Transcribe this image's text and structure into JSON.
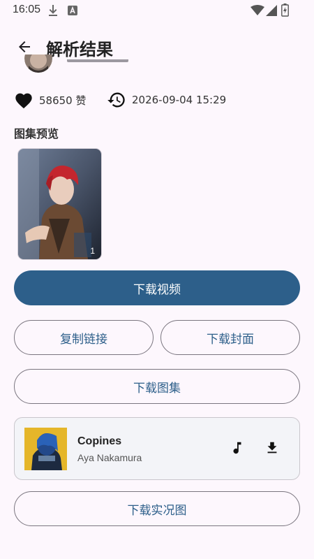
{
  "status_bar": {
    "time": "16:05",
    "icons": [
      "download-icon",
      "a-icon",
      "wifi-icon",
      "signal-icon",
      "battery-icon"
    ]
  },
  "app_bar": {
    "title": "解析结果",
    "back_icon": "arrow-back-icon"
  },
  "stats": {
    "likes": "58650 赞",
    "date": "2026-09-04 15:29"
  },
  "gallery": {
    "title": "图集预览",
    "items": [
      {
        "index": "1"
      }
    ]
  },
  "buttons": {
    "download_video": "下载视频",
    "copy_link": "复制链接",
    "download_cover": "下载封面",
    "download_gallery": "下载图集",
    "download_live": "下载实况图"
  },
  "music": {
    "title": "Copines",
    "artist": "Aya Nakamura",
    "play_icon": "music-note-icon",
    "download_icon": "download-icon"
  },
  "colors": {
    "primary": "#2d5f8a",
    "background": "#fdf7fd",
    "outline": "#7a757f"
  }
}
